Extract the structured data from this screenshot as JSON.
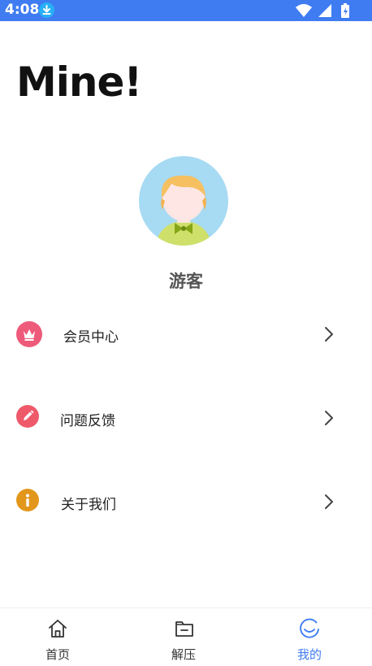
{
  "status_bar": {
    "time": "4:08",
    "bg_color": "#3f7cf2"
  },
  "page": {
    "title": "Mine!"
  },
  "profile": {
    "username": "游客",
    "avatar_bg": "#a7daf3"
  },
  "menu": [
    {
      "label": "会员中心",
      "icon": "crown-icon",
      "icon_color": "#ee5a7a"
    },
    {
      "label": "问题反馈",
      "icon": "pencil-icon",
      "icon_color": "#ee5a6a"
    },
    {
      "label": "关于我们",
      "icon": "info-icon",
      "icon_color": "#e2971c"
    }
  ],
  "bottom_nav": {
    "active_color": "#3f7cf2",
    "items": [
      {
        "label": "首页",
        "icon": "home-icon",
        "active": false
      },
      {
        "label": "解压",
        "icon": "folder-icon",
        "active": false
      },
      {
        "label": "我的",
        "icon": "smile-icon",
        "active": true
      }
    ]
  }
}
